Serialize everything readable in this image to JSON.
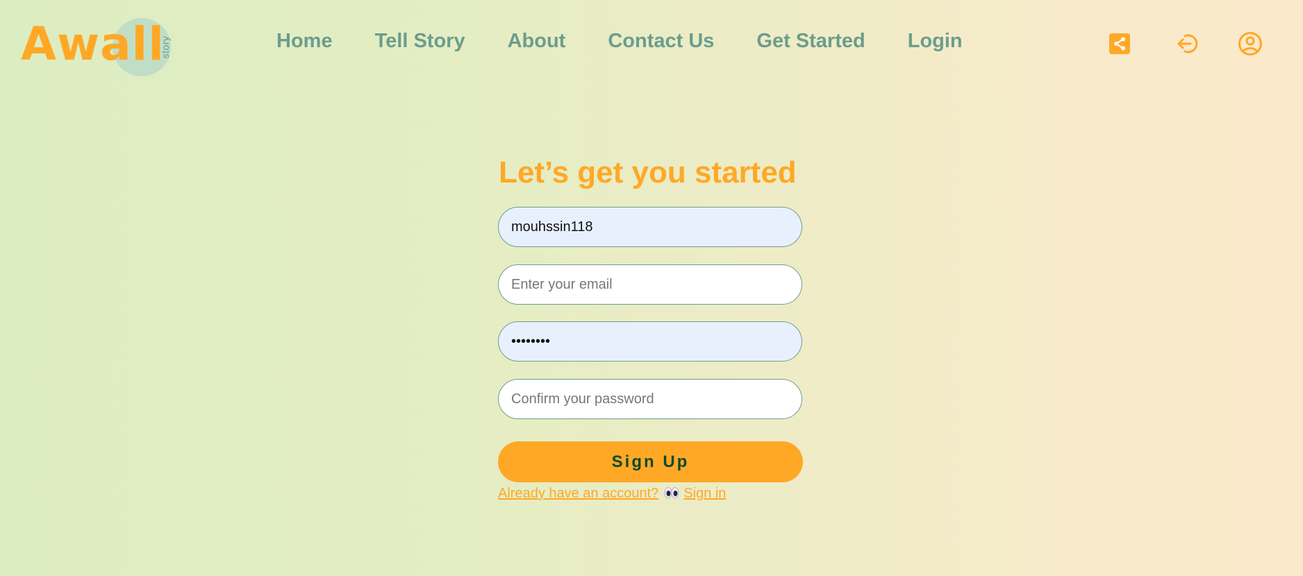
{
  "logo": {
    "word": "Awall",
    "sub": "story"
  },
  "nav": {
    "items": [
      "Home",
      "Tell Story",
      "About",
      "Contact Us",
      "Get Started",
      "Login"
    ]
  },
  "header_icons": {
    "share": "share-icon",
    "logout": "logout-icon",
    "account": "account-icon"
  },
  "form": {
    "title": "Let’s get you started",
    "username_value": "mouhssin118",
    "email_placeholder": "Enter your email",
    "password_value": "••••••••",
    "confirm_placeholder": "Confirm your password",
    "submit_label": "Sign Up",
    "signin_prompt": "Already have an account?",
    "signin_emoji": "eyes-emoji",
    "signin_link": "Sign in"
  },
  "colors": {
    "accent": "#ffa826",
    "nav": "#6b9d8d",
    "button_text": "#0c4a2c",
    "autofill_bg": "#e8f0fe"
  }
}
